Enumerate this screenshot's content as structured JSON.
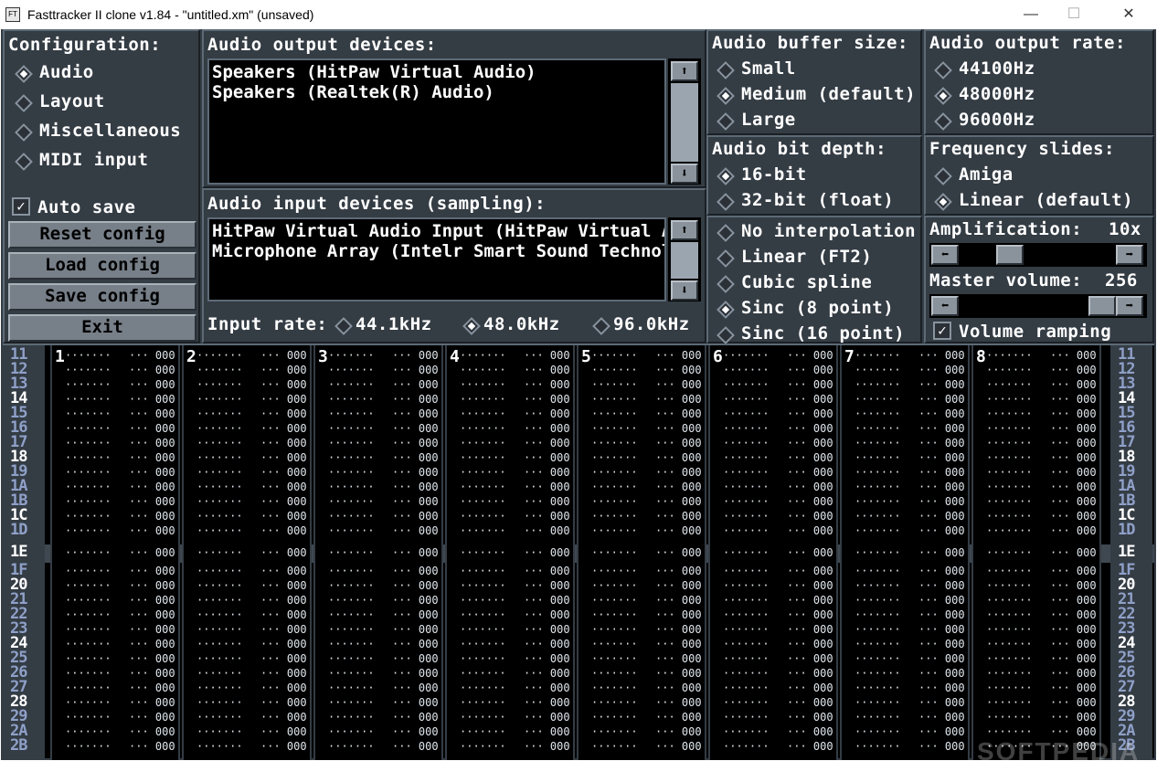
{
  "window": {
    "title": "Fasttracker II clone v1.84 - \"untitled.xm\" (unsaved)",
    "icon": "ft2-app-icon",
    "min_glyph": "—",
    "max_glyph": "☐",
    "close_glyph": "✕"
  },
  "config": {
    "heading": "Configuration:",
    "tabs": [
      {
        "label": "Audio",
        "selected": true
      },
      {
        "label": "Layout",
        "selected": false
      },
      {
        "label": "Miscellaneous",
        "selected": false
      },
      {
        "label": "MIDI input",
        "selected": false
      }
    ],
    "auto_save": {
      "label": "Auto save",
      "checked": true
    },
    "buttons": {
      "reset": "Reset config",
      "load": "Load config",
      "save": "Save config",
      "exit": "Exit"
    }
  },
  "output_devices": {
    "heading": "Audio output devices:",
    "items": [
      "Speakers (HitPaw Virtual Audio)",
      "Speakers (Realtek(R) Audio)"
    ]
  },
  "input_devices": {
    "heading": "Audio input devices (sampling):",
    "items": [
      "HitPaw Virtual Audio Input (HitPaw Virtual Audio)",
      "Microphone Array (Intelr Smart Sound Technology)"
    ]
  },
  "input_rate": {
    "label": "Input rate:",
    "options": [
      {
        "label": "44.1kHz",
        "selected": false
      },
      {
        "label": "48.0kHz",
        "selected": true
      },
      {
        "label": "96.0kHz",
        "selected": false
      }
    ]
  },
  "buffer_size": {
    "heading": "Audio buffer size:",
    "options": [
      {
        "label": "Small",
        "selected": false
      },
      {
        "label": "Medium (default)",
        "selected": true
      },
      {
        "label": "Large",
        "selected": false
      }
    ]
  },
  "output_rate": {
    "heading": "Audio output rate:",
    "options": [
      {
        "label": "44100Hz",
        "selected": false
      },
      {
        "label": "48000Hz",
        "selected": true
      },
      {
        "label": "96000Hz",
        "selected": false
      }
    ]
  },
  "bit_depth": {
    "heading": "Audio bit depth:",
    "options": [
      {
        "label": "16-bit",
        "selected": true
      },
      {
        "label": "32-bit (float)",
        "selected": false
      }
    ]
  },
  "freq_slides": {
    "heading": "Frequency slides:",
    "options": [
      {
        "label": "Amiga",
        "selected": false
      },
      {
        "label": "Linear (default)",
        "selected": true
      }
    ]
  },
  "interpolation": {
    "options": [
      {
        "label": "No interpolation",
        "selected": false
      },
      {
        "label": "Linear (FT2)",
        "selected": false
      },
      {
        "label": "Cubic spline",
        "selected": false
      },
      {
        "label": "Sinc (8 point)",
        "selected": true
      },
      {
        "label": "Sinc (16 point)",
        "selected": false
      }
    ]
  },
  "amplification": {
    "label": "Amplification:",
    "value": "10x",
    "level": 0.28
  },
  "master_volume": {
    "label": "Master volume:",
    "value": "256",
    "level": 1.0
  },
  "volume_ramping": {
    "label": "Volume ramping",
    "checked": true
  },
  "glyphs": {
    "up": "⬆",
    "down": "⬇",
    "left": "⬅",
    "right": "➡",
    "check": "✓"
  },
  "pattern": {
    "channels": [
      "1",
      "2",
      "3",
      "4",
      "5",
      "6",
      "7",
      "8"
    ],
    "rows": [
      "11",
      "12",
      "13",
      "14",
      "15",
      "16",
      "17",
      "18",
      "19",
      "1A",
      "1B",
      "1C",
      "1D",
      "1E",
      "1F",
      "20",
      "21",
      "22",
      "23",
      "24",
      "25",
      "26",
      "27",
      "28",
      "29",
      "2A",
      "2B"
    ],
    "current_row": "1E",
    "empty_note": "·······",
    "empty_fx": "··· 000"
  },
  "watermark": "SOFTPEDIA",
  "colors": {
    "panel": "#343c44",
    "highlight_row": "#ffffff",
    "row_number": "#8fa0c8"
  }
}
